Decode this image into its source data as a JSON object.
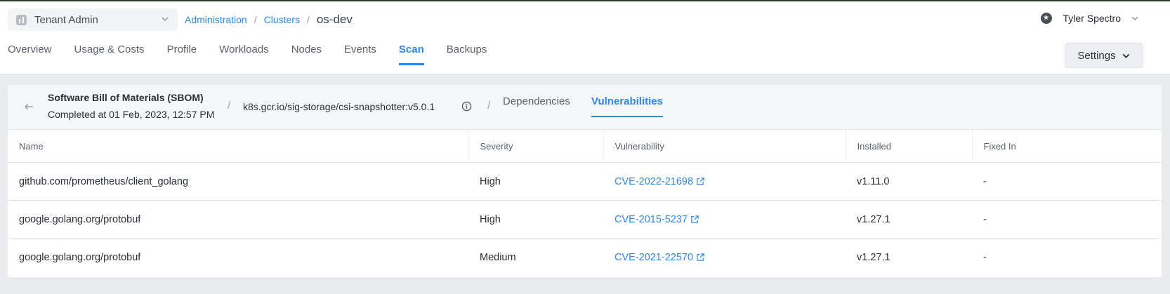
{
  "header": {
    "tenant": "Tenant Admin",
    "breadcrumb": {
      "items": [
        "Administration",
        "Clusters"
      ],
      "current": "os-dev"
    },
    "user_name": "Tyler Spectro",
    "tabs": [
      "Overview",
      "Usage & Costs",
      "Profile",
      "Workloads",
      "Nodes",
      "Events",
      "Scan",
      "Backups"
    ],
    "active_tab": "Scan",
    "settings_label": "Settings"
  },
  "sbom": {
    "title": "Software Bill of Materials (SBOM)",
    "completed": "Completed at 01 Feb, 2023, 12:57 PM",
    "image": "k8s.gcr.io/sig-storage/csi-snapshotter:v5.0.1",
    "tabs": [
      "Dependencies",
      "Vulnerabilities"
    ],
    "active_tab": "Vulnerabilities"
  },
  "table": {
    "columns": [
      "Name",
      "Severity",
      "Vulnerability",
      "Installed",
      "Fixed In"
    ],
    "rows": [
      {
        "name": "github.com/prometheus/client_golang",
        "severity": "High",
        "vulnerability": "CVE-2022-21698",
        "installed": "v1.11.0",
        "fixed_in": "-"
      },
      {
        "name": "google.golang.org/protobuf",
        "severity": "High",
        "vulnerability": "CVE-2015-5237",
        "installed": "v1.27.1",
        "fixed_in": "-"
      },
      {
        "name": "google.golang.org/protobuf",
        "severity": "Medium",
        "vulnerability": "CVE-2021-22570",
        "installed": "v1.27.1",
        "fixed_in": "-"
      }
    ]
  },
  "colors": {
    "accent": "#2f86e3",
    "page_bg": "#e9ebee",
    "text": "#2b2f36"
  },
  "icons": [
    "tenant-icon",
    "chevron-down-icon",
    "user-avatar-icon",
    "back-arrow-icon",
    "info-icon",
    "external-link-icon"
  ]
}
